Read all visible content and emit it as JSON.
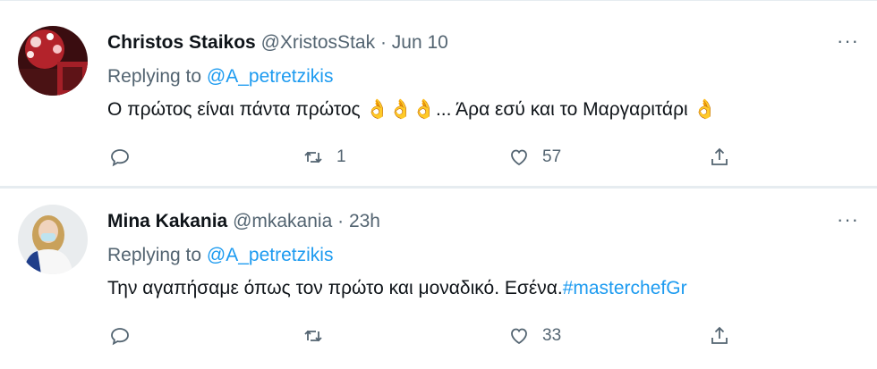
{
  "tweets": [
    {
      "name": "Christos Staikos",
      "handle": "@XristosStak",
      "dot": "·",
      "time": "Jun 10",
      "replying_label": "Replying to ",
      "replying_to": "@A_petretzikis",
      "text_a": "Ο πρώτος είναι πάντα πρώτος ",
      "emoji_a": "👌👌👌",
      "text_b": "... Άρα εσύ και το Μαργαριτάρι ",
      "emoji_b": "👌",
      "reply_count": "",
      "retweet_count": "1",
      "like_count": "57",
      "more": "···"
    },
    {
      "name": "Mina Kakania",
      "handle": "@mkakania",
      "dot": "·",
      "time": "23h",
      "replying_label": "Replying to ",
      "replying_to": "@A_petretzikis",
      "text_a": "Την αγαπήσαμε όπως τον πρώτο και μοναδικό. Εσένα.",
      "hashtag": "#masterchefGr",
      "reply_count": "",
      "retweet_count": "",
      "like_count": "33",
      "more": "···"
    }
  ],
  "icons": {
    "reply": "reply-icon",
    "retweet": "retweet-icon",
    "like": "heart-icon",
    "share": "share-icon",
    "more": "more-icon"
  },
  "colors": {
    "text": "#0f1419",
    "secondary": "#536471",
    "link": "#1d9bf0",
    "divider": "#e6ecf0"
  }
}
